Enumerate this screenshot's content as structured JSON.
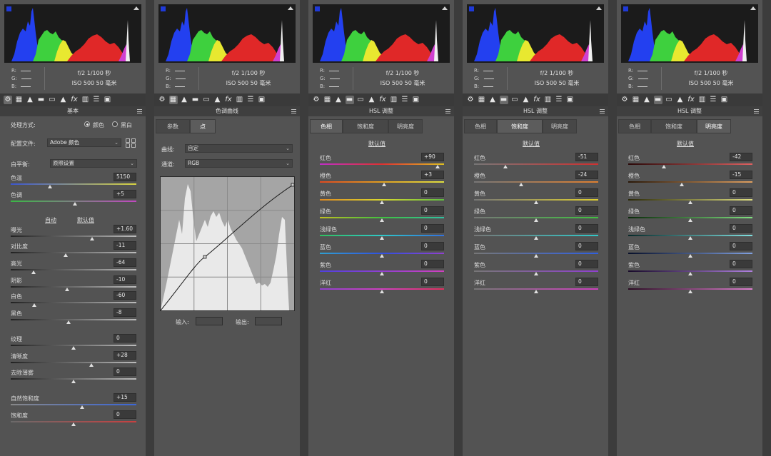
{
  "info": {
    "r_label": "R:",
    "g_label": "G:",
    "b_label": "B:",
    "aperture_shutter": "f/2  1/100 秒",
    "iso_focal": "ISO 500  50 毫米"
  },
  "toolbar_icons": [
    "aperture-icon",
    "histogram-curve-icon",
    "mountain-icon",
    "split-square-icon",
    "bars-icon",
    "detail-icon",
    "fx-icon",
    "lens-icon",
    "sliders-icon",
    "presets-icon"
  ],
  "basic": {
    "title": "基本",
    "treatment_label": "处理方式:",
    "treatment_color": "颜色",
    "treatment_bw": "黑白",
    "profile_label": "配置文件:",
    "profile_value": "Adobe 颜色",
    "wb_label": "白平衡:",
    "wb_value": "原照设置",
    "auto_link": "自动",
    "default_link": "默认值",
    "sliders": [
      {
        "name": "temperature",
        "label": "色温",
        "value": "5150",
        "pos": 0.31,
        "colors": [
          "#3b56d0",
          "#d8d440"
        ]
      },
      {
        "name": "tint",
        "label": "色调",
        "value": "+5",
        "pos": 0.51,
        "colors": [
          "#3ab845",
          "#c048c0"
        ]
      },
      {
        "name": "exposure",
        "label": "曝光",
        "value": "+1.60",
        "pos": 0.65,
        "colors": [
          "#222222",
          "#bbbbbb"
        ]
      },
      {
        "name": "contrast",
        "label": "对比度",
        "value": "-11",
        "pos": 0.44,
        "colors": [
          "#222222",
          "#bbbbbb"
        ]
      },
      {
        "name": "highlights",
        "label": "高光",
        "value": "-64",
        "pos": 0.18,
        "colors": [
          "#222222",
          "#bbbbbb"
        ]
      },
      {
        "name": "shadows",
        "label": "阴影",
        "value": "-10",
        "pos": 0.45,
        "colors": [
          "#222222",
          "#bbbbbb"
        ]
      },
      {
        "name": "whites",
        "label": "白色",
        "value": "-60",
        "pos": 0.19,
        "colors": [
          "#222222",
          "#bbbbbb"
        ]
      },
      {
        "name": "blacks",
        "label": "黑色",
        "value": "-8",
        "pos": 0.46,
        "colors": [
          "#222222",
          "#bbbbbb"
        ]
      },
      {
        "name": "texture",
        "label": "纹理",
        "value": "0",
        "pos": 0.5,
        "colors": [
          "#222222",
          "#bbbbbb"
        ]
      },
      {
        "name": "clarity",
        "label": "清晰度",
        "value": "+28",
        "pos": 0.64,
        "colors": [
          "#222222",
          "#bbbbbb"
        ]
      },
      {
        "name": "dehaze",
        "label": "去除薄雾",
        "value": "0",
        "pos": 0.5,
        "colors": [
          "#222222",
          "#bbbbbb"
        ]
      },
      {
        "name": "vibrance",
        "label": "自然饱和度",
        "value": "+15",
        "pos": 0.57,
        "colors": [
          "#888888",
          "#3a66d8"
        ]
      },
      {
        "name": "saturation",
        "label": "饱和度",
        "value": "0",
        "pos": 0.5,
        "colors": [
          "#6a6a6a",
          "#c84040"
        ]
      }
    ]
  },
  "curve": {
    "title": "色调曲线",
    "tab_param": "参数",
    "tab_point": "点",
    "curve_label": "曲线:",
    "curve_value": "自定",
    "channel_label": "通道:",
    "channel_value": "RGB",
    "input_label": "输入:",
    "output_label": "输出:"
  },
  "hsl_panels": [
    {
      "title": "HSL 调整",
      "active_tab": 0,
      "tabs": [
        "色相",
        "饱和度",
        "明亮度"
      ],
      "default_link": "默认值",
      "rows": [
        {
          "label": "红色",
          "value": "+90",
          "pos": 0.95
        },
        {
          "label": "橙色",
          "value": "+3",
          "pos": 0.52
        },
        {
          "label": "黄色",
          "value": "0",
          "pos": 0.5
        },
        {
          "label": "绿色",
          "value": "0",
          "pos": 0.5
        },
        {
          "label": "浅绿色",
          "value": "0",
          "pos": 0.5
        },
        {
          "label": "蓝色",
          "value": "0",
          "pos": 0.5
        },
        {
          "label": "紫色",
          "value": "0",
          "pos": 0.5
        },
        {
          "label": "洋红",
          "value": "0",
          "pos": 0.5
        }
      ]
    },
    {
      "title": "HSL 调整",
      "active_tab": 1,
      "tabs": [
        "色相",
        "饱和度",
        "明亮度"
      ],
      "default_link": "默认值",
      "rows": [
        {
          "label": "红色",
          "value": "-51",
          "pos": 0.25
        },
        {
          "label": "橙色",
          "value": "-24",
          "pos": 0.38
        },
        {
          "label": "黄色",
          "value": "0",
          "pos": 0.5
        },
        {
          "label": "绿色",
          "value": "0",
          "pos": 0.5
        },
        {
          "label": "浅绿色",
          "value": "0",
          "pos": 0.5
        },
        {
          "label": "蓝色",
          "value": "0",
          "pos": 0.5
        },
        {
          "label": "紫色",
          "value": "0",
          "pos": 0.5
        },
        {
          "label": "洋红",
          "value": "0",
          "pos": 0.5
        }
      ]
    },
    {
      "title": "HSL 调整",
      "active_tab": 2,
      "tabs": [
        "色相",
        "饱和度",
        "明亮度"
      ],
      "default_link": "默认值",
      "rows": [
        {
          "label": "红色",
          "value": "-42",
          "pos": 0.29
        },
        {
          "label": "橙色",
          "value": "-15",
          "pos": 0.43
        },
        {
          "label": "黄色",
          "value": "0",
          "pos": 0.5
        },
        {
          "label": "绿色",
          "value": "0",
          "pos": 0.5
        },
        {
          "label": "浅绿色",
          "value": "0",
          "pos": 0.5
        },
        {
          "label": "蓝色",
          "value": "0",
          "pos": 0.5
        },
        {
          "label": "紫色",
          "value": "0",
          "pos": 0.5
        },
        {
          "label": "洋红",
          "value": "0",
          "pos": 0.5
        }
      ]
    }
  ],
  "hsl_tracks": {
    "hue": [
      [
        "#c02ec8",
        "#e03030",
        "#e0c020"
      ],
      [
        "#e04a20",
        "#e0a020",
        "#e0e040"
      ],
      [
        "#e08a20",
        "#d8d830",
        "#60c040"
      ],
      [
        "#c0c020",
        "#40c040",
        "#30c0a0"
      ],
      [
        "#30c060",
        "#30c8c8",
        "#3070e0"
      ],
      [
        "#30a0d0",
        "#3050e0",
        "#9040d0"
      ],
      [
        "#5040e0",
        "#9040d0",
        "#d040c0"
      ],
      [
        "#9040d0",
        "#d040c0",
        "#e03060"
      ]
    ],
    "saturation": [
      [
        "#777777",
        "#d03030"
      ],
      [
        "#777777",
        "#e08030"
      ],
      [
        "#777777",
        "#e0d030"
      ],
      [
        "#777777",
        "#40c040"
      ],
      [
        "#777777",
        "#30c8c8"
      ],
      [
        "#777777",
        "#3060e0"
      ],
      [
        "#777777",
        "#9040d0"
      ],
      [
        "#777777",
        "#d040c0"
      ]
    ],
    "luminance": [
      [
        "#2a0808",
        "#e06060"
      ],
      [
        "#2a1808",
        "#e0a060"
      ],
      [
        "#2a2808",
        "#e0e080"
      ],
      [
        "#0a2a0a",
        "#80e080"
      ],
      [
        "#082a2a",
        "#80e0e0"
      ],
      [
        "#08102a",
        "#80a0e0"
      ],
      [
        "#180a2a",
        "#b080e0"
      ],
      [
        "#2a0a22",
        "#e080d0"
      ]
    ]
  }
}
